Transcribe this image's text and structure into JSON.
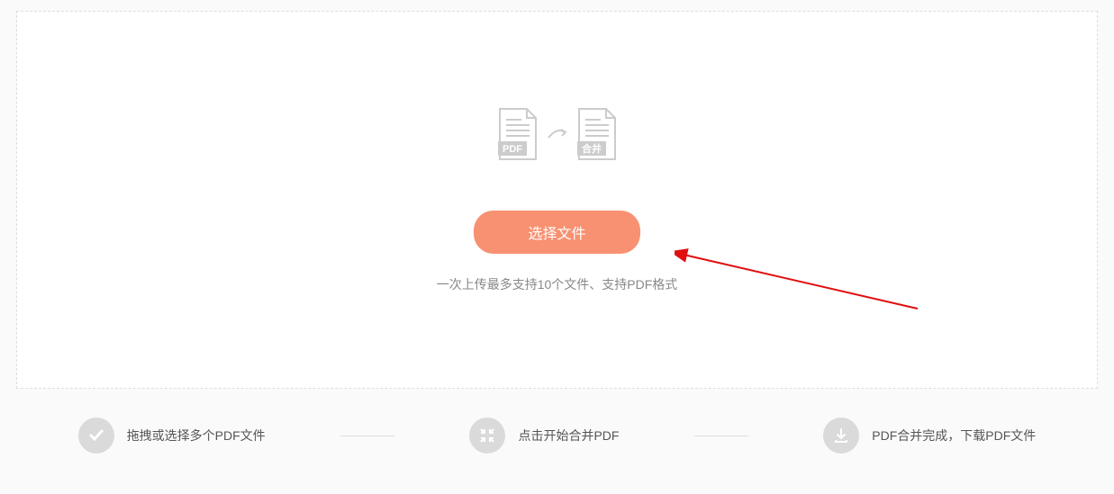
{
  "upload": {
    "source_label": "PDF",
    "target_label": "合并",
    "button_label": "选择文件",
    "hint_text": "一次上传最多支持10个文件、支持PDF格式"
  },
  "steps": {
    "step1": "拖拽或选择多个PDF文件",
    "step2": "点击开始合并PDF",
    "step3": "PDF合并完成，下载PDF文件"
  }
}
